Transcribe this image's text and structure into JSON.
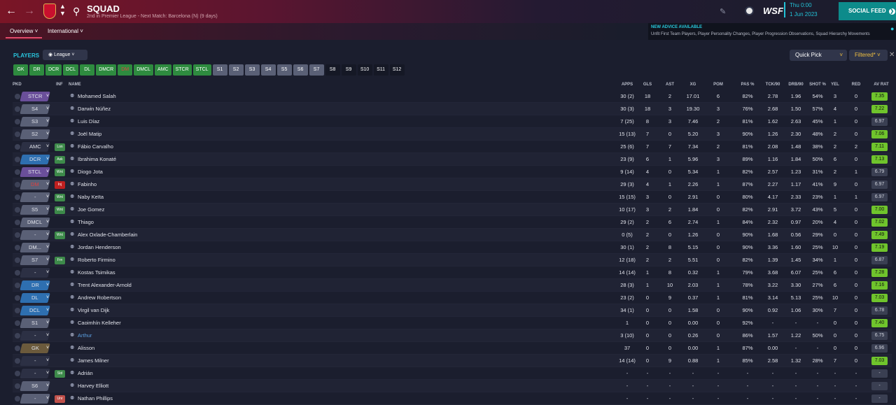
{
  "header": {
    "title": "SQUAD",
    "subtitle": "2nd in Premier League - Next Match: Barcelona (N) (9 days)",
    "date_time": "Thu 0:00",
    "date_day": "1 Jun 2023",
    "brand": "WSF",
    "social_feed_label": "SOCIAL FEED"
  },
  "subnav": {
    "overview_label": "Overview",
    "international_label": "International"
  },
  "advice": {
    "title": "NEW ADVICE AVAILABLE",
    "text": "Unfit First Team Players, Player Personality Changes, Player Progression Observations, Squad Hierarchy Movements"
  },
  "toolbar": {
    "players_label": "PLAYERS",
    "league_label": "League",
    "quick_pick_label": "Quick Pick",
    "filtered_label": "Filtered*"
  },
  "position_filters": [
    {
      "label": "GK",
      "style": "green"
    },
    {
      "label": "DR",
      "style": "green"
    },
    {
      "label": "DCR",
      "style": "green"
    },
    {
      "label": "DCL",
      "style": "green"
    },
    {
      "label": "DL",
      "style": "green"
    },
    {
      "label": "DMCR",
      "style": "green"
    },
    {
      "label": "DM",
      "style": "red"
    },
    {
      "label": "DMCL",
      "style": "green"
    },
    {
      "label": "AMC",
      "style": "green"
    },
    {
      "label": "STCR",
      "style": "green"
    },
    {
      "label": "STCL",
      "style": "green"
    },
    {
      "label": "S1",
      "style": "grey"
    },
    {
      "label": "S2",
      "style": "grey"
    },
    {
      "label": "S3",
      "style": "grey"
    },
    {
      "label": "S4",
      "style": "grey"
    },
    {
      "label": "S5",
      "style": "grey"
    },
    {
      "label": "S6",
      "style": "grey"
    },
    {
      "label": "S7",
      "style": "grey"
    },
    {
      "label": "S8",
      "style": "dark"
    },
    {
      "label": "S9",
      "style": "dark"
    },
    {
      "label": "S10",
      "style": "dark"
    },
    {
      "label": "S11",
      "style": "dark"
    },
    {
      "label": "S12",
      "style": "dark"
    }
  ],
  "columns": [
    "PKD",
    "INF",
    "NAME",
    "APPS",
    "GLS",
    "AST",
    "XG",
    "POM",
    "PAS %",
    "TCK/90",
    "DRB/90",
    "SHOT %",
    "YEL",
    "RED",
    "AV RAT"
  ],
  "rows": [
    {
      "pos": "STCR",
      "pos_color": "#6a4f9a",
      "inf": "",
      "name": "Mohamed Salah",
      "apps": "30 (2)",
      "gls": "18",
      "ast": "2",
      "xg": "17.01",
      "pom": "6",
      "pas": "82%",
      "tck": "2.78",
      "drb": "1.96",
      "shot": "54%",
      "yel": "3",
      "red": "0",
      "rat": "7.35",
      "rat_good": true
    },
    {
      "pos": "S4",
      "pos_color": "#5a6076",
      "inf": "",
      "name": "Darwin Núñez",
      "apps": "30 (3)",
      "gls": "18",
      "ast": "3",
      "xg": "19.30",
      "pom": "3",
      "pas": "76%",
      "tck": "2.68",
      "drb": "1.50",
      "shot": "57%",
      "yel": "4",
      "red": "0",
      "rat": "7.22",
      "rat_good": true
    },
    {
      "pos": "S3",
      "pos_color": "#5a6076",
      "inf": "",
      "name": "Luis Díaz",
      "apps": "7 (25)",
      "gls": "8",
      "ast": "3",
      "xg": "7.46",
      "pom": "2",
      "pas": "81%",
      "tck": "1.62",
      "drb": "2.63",
      "shot": "45%",
      "yel": "1",
      "red": "0",
      "rat": "6.97",
      "rat_good": false
    },
    {
      "pos": "S2",
      "pos_color": "#5a6076",
      "inf": "",
      "name": "Joël Matip",
      "apps": "15 (13)",
      "gls": "7",
      "ast": "0",
      "xg": "5.20",
      "pom": "3",
      "pas": "90%",
      "tck": "1.26",
      "drb": "2.30",
      "shot": "48%",
      "yel": "2",
      "red": "0",
      "rat": "7.06",
      "rat_good": true
    },
    {
      "pos": "AMC",
      "pos_color": "#2c3044",
      "inf": "Lon",
      "inf_color": "#3d8a4a",
      "name": "Fábio Carvalho",
      "apps": "25 (6)",
      "gls": "7",
      "ast": "7",
      "xg": "7.34",
      "pom": "2",
      "pas": "81%",
      "tck": "2.08",
      "drb": "1.48",
      "shot": "38%",
      "yel": "2",
      "red": "2",
      "rat": "7.11",
      "rat_good": true
    },
    {
      "pos": "DCR",
      "pos_color": "#2e6fb0",
      "inf": "Ask",
      "inf_color": "#3d8a4a",
      "name": "Ibrahima Konaté",
      "apps": "23 (9)",
      "gls": "6",
      "ast": "1",
      "xg": "5.96",
      "pom": "3",
      "pas": "89%",
      "tck": "1.16",
      "drb": "1.84",
      "shot": "50%",
      "yel": "6",
      "red": "0",
      "rat": "7.13",
      "rat_good": true
    },
    {
      "pos": "STCL",
      "pos_color": "#6a4f9a",
      "inf": "Wnt",
      "inf_color": "#3d8a4a",
      "name": "Diogo Jota",
      "apps": "9 (14)",
      "gls": "4",
      "ast": "0",
      "xg": "5.34",
      "pom": "1",
      "pas": "82%",
      "tck": "2.57",
      "drb": "1.23",
      "shot": "31%",
      "yel": "2",
      "red": "1",
      "rat": "6.79",
      "rat_good": false
    },
    {
      "pos": "DM",
      "pos_color": "#5a6076",
      "pos_text": "#e04040",
      "inf": "Inj",
      "inf_color": "#c02020",
      "name": "Fabinho",
      "apps": "29 (3)",
      "gls": "4",
      "ast": "1",
      "xg": "2.26",
      "pom": "1",
      "pas": "87%",
      "tck": "2.27",
      "drb": "1.17",
      "shot": "41%",
      "yel": "9",
      "red": "0",
      "rat": "6.97",
      "rat_good": false
    },
    {
      "pos": "-",
      "pos_color": "#5a6076",
      "inf": "Wnt",
      "inf_color": "#3d8a4a",
      "name": "Naby Keïta",
      "apps": "15 (15)",
      "gls": "3",
      "ast": "0",
      "xg": "2.91",
      "pom": "0",
      "pas": "80%",
      "tck": "4.17",
      "drb": "2.33",
      "shot": "23%",
      "yel": "1",
      "red": "1",
      "rat": "6.97",
      "rat_good": false
    },
    {
      "pos": "S5",
      "pos_color": "#5a6076",
      "inf": "Wnt",
      "inf_color": "#3d8a4a",
      "name": "Joe Gomez",
      "apps": "10 (17)",
      "gls": "3",
      "ast": "2",
      "xg": "1.84",
      "pom": "0",
      "pas": "82%",
      "tck": "2.91",
      "drb": "3.72",
      "shot": "43%",
      "yel": "5",
      "red": "0",
      "rat": "7.00",
      "rat_good": true
    },
    {
      "pos": "DMCL",
      "pos_color": "#5a6076",
      "inf": "",
      "name": "Thiago",
      "apps": "29 (2)",
      "gls": "2",
      "ast": "6",
      "xg": "2.74",
      "pom": "1",
      "pas": "84%",
      "tck": "2.32",
      "drb": "0.97",
      "shot": "20%",
      "yel": "4",
      "red": "0",
      "rat": "7.02",
      "rat_good": true
    },
    {
      "pos": "-",
      "pos_color": "#5a6076",
      "inf": "Wnt",
      "inf_color": "#3d8a4a",
      "name": "Alex Oxlade-Chamberlain",
      "apps": "0 (5)",
      "gls": "2",
      "ast": "0",
      "xg": "1.26",
      "pom": "0",
      "pas": "90%",
      "tck": "1.68",
      "drb": "0.56",
      "shot": "29%",
      "yel": "0",
      "red": "0",
      "rat": "7.49",
      "rat_good": true
    },
    {
      "pos": "DM...",
      "pos_color": "#5a6076",
      "inf": "",
      "name": "Jordan Henderson",
      "apps": "30 (1)",
      "gls": "2",
      "ast": "8",
      "xg": "5.15",
      "pom": "0",
      "pas": "90%",
      "tck": "3.36",
      "drb": "1.60",
      "shot": "25%",
      "yel": "10",
      "red": "0",
      "rat": "7.19",
      "rat_good": true
    },
    {
      "pos": "S7",
      "pos_color": "#5a6076",
      "inf": "Frn",
      "inf_color": "#3d8a4a",
      "name": "Roberto Firmino",
      "apps": "12 (18)",
      "gls": "2",
      "ast": "2",
      "xg": "5.51",
      "pom": "0",
      "pas": "82%",
      "tck": "1.39",
      "drb": "1.45",
      "shot": "34%",
      "yel": "1",
      "red": "0",
      "rat": "6.87",
      "rat_good": false
    },
    {
      "pos": "-",
      "pos_color": "#2c3044",
      "inf": "",
      "name": "Kostas Tsimikas",
      "apps": "14 (14)",
      "gls": "1",
      "ast": "8",
      "xg": "0.32",
      "pom": "1",
      "pas": "79%",
      "tck": "3.68",
      "drb": "6.07",
      "shot": "25%",
      "yel": "6",
      "red": "0",
      "rat": "7.28",
      "rat_good": true
    },
    {
      "pos": "DR",
      "pos_color": "#2e6fb0",
      "inf": "",
      "name": "Trent Alexander-Arnold",
      "apps": "28 (3)",
      "gls": "1",
      "ast": "10",
      "xg": "2.03",
      "pom": "1",
      "pas": "78%",
      "tck": "3.22",
      "drb": "3.30",
      "shot": "27%",
      "yel": "6",
      "red": "0",
      "rat": "7.16",
      "rat_good": true
    },
    {
      "pos": "DL",
      "pos_color": "#2e6fb0",
      "inf": "",
      "name": "Andrew Robertson",
      "apps": "23 (2)",
      "gls": "0",
      "ast": "9",
      "xg": "0.37",
      "pom": "1",
      "pas": "81%",
      "tck": "3.14",
      "drb": "5.13",
      "shot": "25%",
      "yel": "10",
      "red": "0",
      "rat": "7.03",
      "rat_good": true
    },
    {
      "pos": "DCL",
      "pos_color": "#2e6fb0",
      "inf": "",
      "name": "Virgil van Dijk",
      "apps": "34 (1)",
      "gls": "0",
      "ast": "0",
      "xg": "1.58",
      "pom": "0",
      "pas": "90%",
      "tck": "0.92",
      "drb": "1.06",
      "shot": "30%",
      "yel": "7",
      "red": "0",
      "rat": "6.78",
      "rat_good": false
    },
    {
      "pos": "S1",
      "pos_color": "#5a6076",
      "inf": "",
      "name": "Caoimhín Kelleher",
      "apps": "1",
      "gls": "0",
      "ast": "0",
      "xg": "0.00",
      "pom": "0",
      "pas": "92%",
      "tck": "-",
      "drb": "-",
      "shot": "-",
      "yel": "0",
      "red": "0",
      "rat": "7.40",
      "rat_good": true
    },
    {
      "pos": "-",
      "pos_color": "#2c3044",
      "inf": "",
      "name": "Arthur",
      "name_color": "#5a9fe0",
      "apps": "3 (10)",
      "gls": "0",
      "ast": "0",
      "xg": "0.26",
      "pom": "0",
      "pas": "86%",
      "tck": "1.57",
      "drb": "1.22",
      "shot": "50%",
      "yel": "0",
      "red": "0",
      "rat": "6.75",
      "rat_good": false
    },
    {
      "pos": "GK",
      "pos_color": "#6b5a3c",
      "inf": "",
      "name": "Alisson",
      "apps": "37",
      "gls": "0",
      "ast": "0",
      "xg": "0.00",
      "pom": "1",
      "pas": "87%",
      "tck": "0.00",
      "drb": "-",
      "shot": "-",
      "yel": "0",
      "red": "0",
      "rat": "6.96",
      "rat_good": false
    },
    {
      "pos": "-",
      "pos_color": "#2c3044",
      "inf": "",
      "name": "James Milner",
      "apps": "14 (14)",
      "gls": "0",
      "ast": "9",
      "xg": "0.88",
      "pom": "1",
      "pas": "85%",
      "tck": "2.58",
      "drb": "1.32",
      "shot": "28%",
      "yel": "7",
      "red": "0",
      "rat": "7.03",
      "rat_good": true
    },
    {
      "pos": "-",
      "pos_color": "#2c3044",
      "inf": "Std",
      "inf_color": "#3d8a4a",
      "name": "Adrián",
      "apps": "-",
      "gls": "-",
      "ast": "-",
      "xg": "-",
      "pom": "-",
      "pas": "-",
      "tck": "-",
      "drb": "-",
      "shot": "-",
      "yel": "-",
      "red": "-",
      "rat": "-",
      "rat_good": false
    },
    {
      "pos": "S6",
      "pos_color": "#5a6076",
      "inf": "",
      "name": "Harvey Elliott",
      "apps": "-",
      "gls": "-",
      "ast": "-",
      "xg": "-",
      "pom": "-",
      "pas": "-",
      "tck": "-",
      "drb": "-",
      "shot": "-",
      "yel": "-",
      "red": "-",
      "rat": "-",
      "rat_good": false
    },
    {
      "pos": "-",
      "pos_color": "#5a6076",
      "inf": "Unr",
      "inf_color": "#c0504a",
      "name": "Nathan Phillips",
      "apps": "-",
      "gls": "-",
      "ast": "-",
      "xg": "-",
      "pom": "-",
      "pas": "-",
      "tck": "-",
      "drb": "-",
      "shot": "-",
      "yel": "-",
      "red": "-",
      "rat": "-",
      "rat_good": false
    }
  ]
}
